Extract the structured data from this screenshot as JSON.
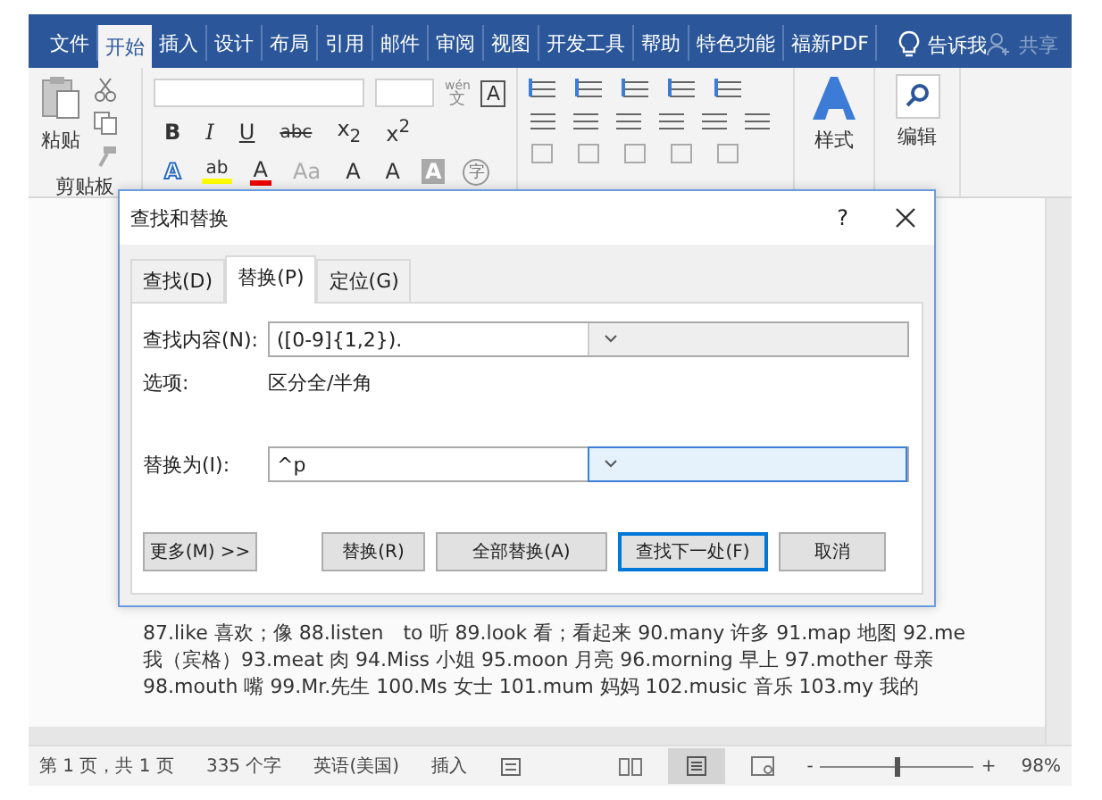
{
  "ribbon_tabs": [
    {
      "label": "文件",
      "selected": false
    },
    {
      "label": "开始",
      "selected": true
    },
    {
      "label": "插入",
      "selected": false
    },
    {
      "label": "设计",
      "selected": false
    },
    {
      "label": "布局",
      "selected": false
    },
    {
      "label": "引用",
      "selected": false
    },
    {
      "label": "邮件",
      "selected": false
    },
    {
      "label": "审阅",
      "selected": false
    },
    {
      "label": "视图",
      "selected": false
    },
    {
      "label": "开发工具",
      "selected": false
    },
    {
      "label": "帮助",
      "selected": false
    },
    {
      "label": "特色功能",
      "selected": false
    },
    {
      "label": "福新PDF",
      "selected": false
    }
  ],
  "tell_me": "告诉我",
  "share": "共享",
  "ribbon": {
    "paste": "粘贴",
    "font_row1": [
      {
        "label": "B",
        "kind": "bold"
      },
      {
        "label": "I",
        "kind": "italic"
      },
      {
        "label": "U",
        "kind": "underline"
      },
      {
        "label": "abc",
        "kind": "strike"
      },
      {
        "label": "x$_{2}$",
        "kind": "plain"
      },
      {
        "label": "x$^{2}$",
        "kind": "plain"
      }
    ],
    "font_row2": [
      {
        "label": "A",
        "kind": "effect"
      },
      {
        "label": "ab",
        "kind": "highlight"
      },
      {
        "label": "A",
        "kind": "color"
      },
      {
        "label": "Aa",
        "kind": "muted"
      },
      {
        "label": "A",
        "kind": "plain"
      },
      {
        "label": "A",
        "kind": "plain"
      },
      {
        "label": "A",
        "kind": "shade"
      },
      {
        "label": "字",
        "kind": "circle"
      }
    ],
    "phonetic": {
      "top": "wén",
      "bottom": "文"
    },
    "border_char": "A",
    "groups": [
      "剪贴板"
    ],
    "styles": "样式",
    "editing": "编辑"
  },
  "document": {
    "lines": [
      "87.like 喜欢；像 88.listen　to 听 89.look 看；看起来 90.many 许多 91.map 地图 92.me",
      "我（宾格）93.meat 肉 94.Miss 小姐 95.moon 月亮 96.morning 早上 97.mother 母亲",
      "98.mouth 嘴 99.Mr.先生 100.Ms 女士 101.mum 妈妈 102.music 音乐 103.my 我的"
    ]
  },
  "dialog": {
    "title": "查找和替换",
    "help": "?",
    "tabs": [
      {
        "label": "查找(D)",
        "selected": false
      },
      {
        "label": "替换(P)",
        "selected": true
      },
      {
        "label": "定位(G)",
        "selected": false
      }
    ],
    "find": {
      "label": "查找内容(N):",
      "value": "([0-9]{1,2}).",
      "focused": false
    },
    "options": {
      "label": "选项:",
      "value": "区分全/半角"
    },
    "replace": {
      "label": "替换为(I):",
      "value": "^p",
      "focused": true
    },
    "buttons": [
      {
        "label": "更多(M) >>",
        "default": false
      },
      {
        "label": "替换(R)",
        "default": false
      },
      {
        "label": "全部替换(A)",
        "default": false
      },
      {
        "label": "查找下一处(F)",
        "default": true
      },
      {
        "label": "取消",
        "default": false
      }
    ]
  },
  "status_bar": {
    "items": [
      "第 1 页，共 1 页",
      "335 个字",
      "英语(美国)",
      "插入"
    ],
    "zoom_out": "-",
    "zoom_in": "+",
    "zoom": {
      "level": 0.49
    },
    "zoom_text": "98%"
  }
}
